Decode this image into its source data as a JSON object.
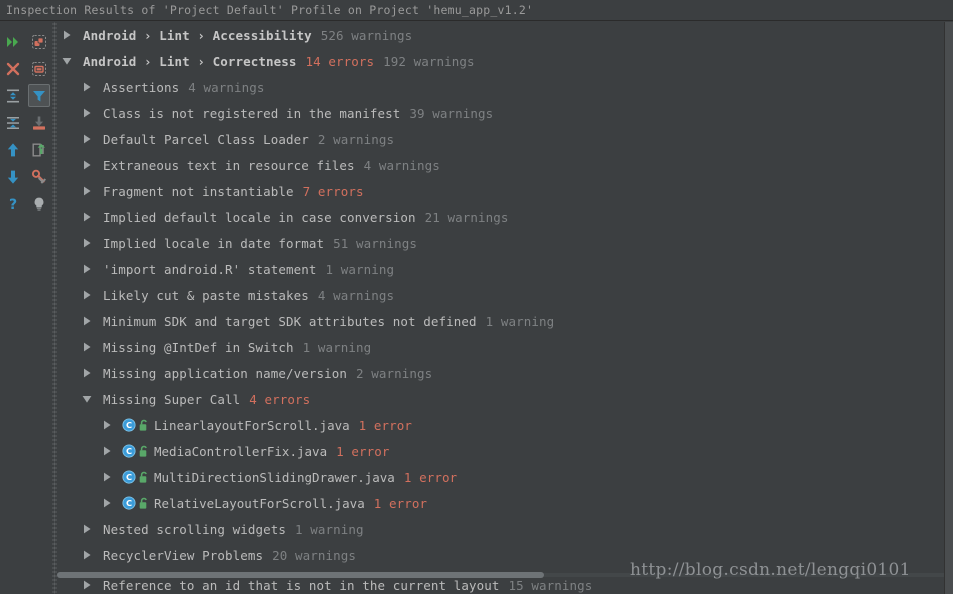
{
  "window": {
    "title": "Inspection Results of 'Project Default' Profile on Project 'hemu_app_v1.2'"
  },
  "colors": {
    "background": "#3c3f41",
    "text": "#bbbbbb",
    "muted": "#7e8183",
    "error": "#d2705e",
    "accent_blue": "#3592c4",
    "accent_green": "#59a869",
    "selected_toolbar": "#4e5254"
  },
  "toolbar": {
    "items": [
      {
        "name": "rerun-inspection-button",
        "icon": "double-right-arrow-icon",
        "selected": false
      },
      {
        "name": "group-by-severity-button",
        "icon": "group-modules-icon",
        "selected": false
      },
      {
        "name": "close-inspection-button",
        "icon": "close-x-icon",
        "selected": false
      },
      {
        "name": "group-by-directory-button",
        "icon": "folder-outline-icon",
        "selected": false
      },
      {
        "name": "expand-all-button",
        "icon": "expand-all-icon",
        "selected": false
      },
      {
        "name": "filter-inspections-button",
        "icon": "filter-funnel-icon",
        "selected": true
      },
      {
        "name": "collapse-all-button",
        "icon": "collapse-all-icon",
        "selected": false
      },
      {
        "name": "export-results-button",
        "icon": "export-download-icon",
        "selected": false
      },
      {
        "name": "previous-occurrence-button",
        "icon": "arrow-up-icon",
        "selected": false
      },
      {
        "name": "open-in-editor-button",
        "icon": "open-external-icon",
        "selected": false
      },
      {
        "name": "next-occurrence-button",
        "icon": "arrow-down-icon",
        "selected": false
      },
      {
        "name": "edit-settings-button",
        "icon": "wrench-settings-icon",
        "selected": false
      },
      {
        "name": "help-button",
        "icon": "question-mark-icon",
        "selected": false
      },
      {
        "name": "quick-fix-button",
        "icon": "lightbulb-icon",
        "selected": false
      }
    ]
  },
  "tree": {
    "rows": [
      {
        "indent": 0,
        "expanded": false,
        "bold": true,
        "label": "Android › Lint › Accessibility",
        "counts": [
          {
            "text": "526 warnings",
            "kind": "warn"
          }
        ]
      },
      {
        "indent": 0,
        "expanded": true,
        "bold": true,
        "label": "Android › Lint › Correctness",
        "counts": [
          {
            "text": "14 errors",
            "kind": "err"
          },
          {
            "text": "192 warnings",
            "kind": "warn"
          }
        ]
      },
      {
        "indent": 1,
        "expanded": false,
        "bold": false,
        "label": "Assertions",
        "counts": [
          {
            "text": "4 warnings",
            "kind": "warn"
          }
        ]
      },
      {
        "indent": 1,
        "expanded": false,
        "bold": false,
        "label": "Class is not registered in the manifest",
        "counts": [
          {
            "text": "39 warnings",
            "kind": "warn"
          }
        ]
      },
      {
        "indent": 1,
        "expanded": false,
        "bold": false,
        "label": "Default Parcel Class Loader",
        "counts": [
          {
            "text": "2 warnings",
            "kind": "warn"
          }
        ]
      },
      {
        "indent": 1,
        "expanded": false,
        "bold": false,
        "label": "Extraneous text in resource files",
        "counts": [
          {
            "text": "4 warnings",
            "kind": "warn"
          }
        ]
      },
      {
        "indent": 1,
        "expanded": false,
        "bold": false,
        "label": "Fragment not instantiable",
        "counts": [
          {
            "text": "7 errors",
            "kind": "err"
          }
        ]
      },
      {
        "indent": 1,
        "expanded": false,
        "bold": false,
        "label": "Implied default locale in case conversion",
        "counts": [
          {
            "text": "21 warnings",
            "kind": "warn"
          }
        ]
      },
      {
        "indent": 1,
        "expanded": false,
        "bold": false,
        "label": "Implied locale in date format",
        "counts": [
          {
            "text": "51 warnings",
            "kind": "warn"
          }
        ]
      },
      {
        "indent": 1,
        "expanded": false,
        "bold": false,
        "label": "'import android.R' statement",
        "counts": [
          {
            "text": "1 warning",
            "kind": "warn"
          }
        ]
      },
      {
        "indent": 1,
        "expanded": false,
        "bold": false,
        "label": "Likely cut & paste mistakes",
        "counts": [
          {
            "text": "4 warnings",
            "kind": "warn"
          }
        ]
      },
      {
        "indent": 1,
        "expanded": false,
        "bold": false,
        "label": "Minimum SDK and target SDK attributes not defined",
        "counts": [
          {
            "text": "1 warning",
            "kind": "warn"
          }
        ]
      },
      {
        "indent": 1,
        "expanded": false,
        "bold": false,
        "label": "Missing @IntDef in Switch",
        "counts": [
          {
            "text": "1 warning",
            "kind": "warn"
          }
        ]
      },
      {
        "indent": 1,
        "expanded": false,
        "bold": false,
        "label": "Missing application name/version",
        "counts": [
          {
            "text": "2 warnings",
            "kind": "warn"
          }
        ]
      },
      {
        "indent": 1,
        "expanded": true,
        "bold": false,
        "label": "Missing Super Call",
        "counts": [
          {
            "text": "4 errors",
            "kind": "err"
          }
        ]
      },
      {
        "indent": 2,
        "expanded": false,
        "file": true,
        "label": "LinearlayoutForScroll.java",
        "counts": [
          {
            "text": "1 error",
            "kind": "err"
          }
        ]
      },
      {
        "indent": 2,
        "expanded": false,
        "file": true,
        "label": "MediaControllerFix.java",
        "counts": [
          {
            "text": "1 error",
            "kind": "err"
          }
        ]
      },
      {
        "indent": 2,
        "expanded": false,
        "file": true,
        "label": "MultiDirectionSlidingDrawer.java",
        "counts": [
          {
            "text": "1 error",
            "kind": "err"
          }
        ]
      },
      {
        "indent": 2,
        "expanded": false,
        "file": true,
        "label": "RelativeLayoutForScroll.java",
        "counts": [
          {
            "text": "1 error",
            "kind": "err"
          }
        ]
      },
      {
        "indent": 1,
        "expanded": false,
        "bold": false,
        "label": "Nested scrolling widgets",
        "counts": [
          {
            "text": "1 warning",
            "kind": "warn"
          }
        ]
      },
      {
        "indent": 1,
        "expanded": false,
        "bold": false,
        "label": "RecyclerView Problems",
        "counts": [
          {
            "text": "20 warnings",
            "kind": "warn"
          }
        ]
      }
    ],
    "clipped_row": {
      "indent": 1,
      "expanded": false,
      "bold": false,
      "label": "Reference to an id that is not in the current layout",
      "counts": [
        {
          "text": "15 warnings",
          "kind": "warn"
        }
      ]
    }
  },
  "watermark": {
    "text": "http://blog.csdn.net/lengqi0101"
  }
}
